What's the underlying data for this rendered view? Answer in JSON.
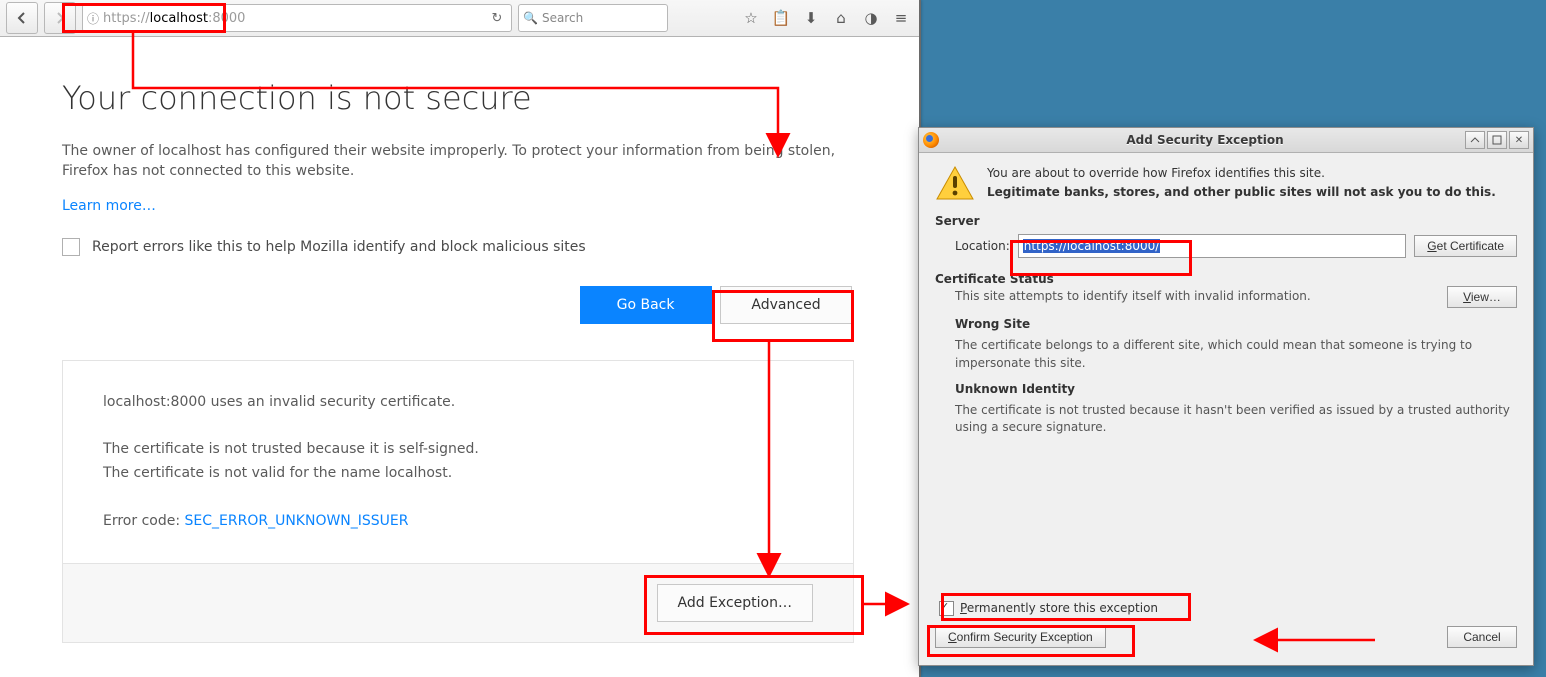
{
  "browser": {
    "url_gray_prefix": "https://",
    "url_bold": "localhost",
    "url_gray_suffix": ":8000",
    "search_placeholder": "Search"
  },
  "page": {
    "heading": "Your connection is not secure",
    "para": "The owner of localhost has configured their website improperly. To protect your information from being stolen, Firefox has not connected to this website.",
    "learn_more": "Learn more…",
    "report_label": "Report errors like this to help Mozilla identify and block malicious sites",
    "go_back": "Go Back",
    "advanced": "Advanced",
    "adv_line1": "localhost:8000 uses an invalid security certificate.",
    "adv_line2": "The certificate is not trusted because it is self-signed.",
    "adv_line3": "The certificate is not valid for the name localhost.",
    "err_label": "Error code: ",
    "err_code": "SEC_ERROR_UNKNOWN_ISSUER",
    "add_exception": "Add Exception…"
  },
  "dialog": {
    "title": "Add Security Exception",
    "warn_line1": "You are about to override how Firefox identifies this site.",
    "warn_line2": "Legitimate banks, stores, and other public sites will not ask you to do this.",
    "server_head": "Server",
    "location_label": "Location:",
    "location_value": "https://localhost:8000/",
    "get_cert": "Get Certificate",
    "cert_status_head": "Certificate Status",
    "cert_status_desc": "This site attempts to identify itself with invalid information.",
    "view_btn": "View…",
    "wrong_site_head": "Wrong Site",
    "wrong_site_desc": "The certificate belongs to a different site, which could mean that someone is trying to impersonate this site.",
    "unknown_head": "Unknown Identity",
    "unknown_desc": "The certificate is not trusted because it hasn't been verified as issued by a trusted authority using a secure signature.",
    "perma_label": "Permanently store this exception",
    "confirm_btn": "Confirm Security Exception",
    "cancel_btn": "Cancel"
  }
}
